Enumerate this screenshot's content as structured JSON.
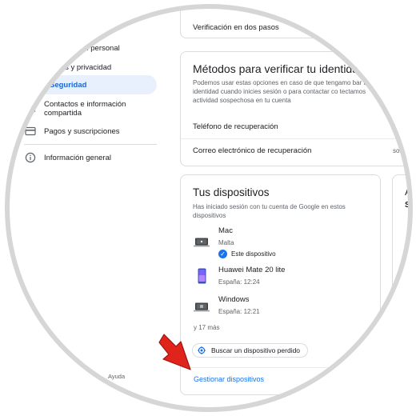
{
  "sidebar": {
    "items": [
      {
        "label": "Información personal",
        "icon": "person-icon"
      },
      {
        "label": "Datos y privacidad",
        "icon": "toggle-icon"
      },
      {
        "label": "Seguridad",
        "icon": "lock-icon",
        "active": true
      },
      {
        "label": "Contactos e información compartida",
        "icon": "people-icon"
      },
      {
        "label": "Pagos y suscripciones",
        "icon": "card-icon"
      },
      {
        "label": "Información general",
        "icon": "info-icon"
      }
    ],
    "footer": {
      "help": "Ayuda",
      "dots": "..."
    }
  },
  "two_step": {
    "label": "Verificación en dos pasos"
  },
  "verify_methods": {
    "title": "Métodos para verificar tu identida",
    "description": "Podemos usar estas opciones en caso de que tengamo bar tu identidad cuando inicies sesión o para contactar co tectamos actividad sospechosa en tu cuenta",
    "rows": [
      {
        "label": "Teléfono de recuperación",
        "value": "/"
      },
      {
        "label": "Correo electrónico de recuperación",
        "value": "sol"
      }
    ]
  },
  "devices": {
    "title": "Tus dispositivos",
    "description": "Has iniciado sesión con tu cuenta de Google en estos dispositivos",
    "items": [
      {
        "name": "Mac",
        "location": "Malta",
        "flag": "Este dispositivo",
        "icon": "laptop-icon"
      },
      {
        "name": "Huawei Mate 20 lite",
        "location": "España: 12:24",
        "icon": "phone-icon"
      },
      {
        "name": "Windows",
        "location": "España: 12:21",
        "icon": "laptop-icon"
      }
    ],
    "more": "y 17 más",
    "find_button": "Buscar un dispositivo perdido",
    "manage_link": "Gestionar dispositivos"
  },
  "right_card": {
    "letter_a": "A",
    "letter_s": "S"
  },
  "colors": {
    "accent": "#1a73e8",
    "active_bg": "#e8f0fe",
    "arrow": "#e0241b",
    "mask": "#d9d9d9"
  }
}
